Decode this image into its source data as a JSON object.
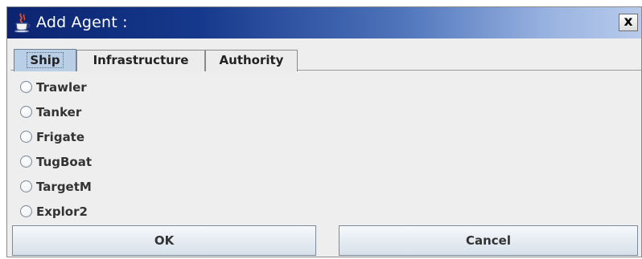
{
  "window": {
    "title": "Add Agent :",
    "close_glyph": "x"
  },
  "tabs": [
    {
      "label": "Ship",
      "selected": true
    },
    {
      "label": "Infrastructure",
      "selected": false
    },
    {
      "label": "Authority",
      "selected": false
    }
  ],
  "agent_options": [
    {
      "label": "Trawler",
      "selected": false
    },
    {
      "label": "Tanker",
      "selected": false
    },
    {
      "label": "Frigate",
      "selected": false
    },
    {
      "label": "TugBoat",
      "selected": false
    },
    {
      "label": "TargetM",
      "selected": false
    },
    {
      "label": "Explor2",
      "selected": false
    }
  ],
  "buttons": {
    "ok_label": "OK",
    "cancel_label": "Cancel"
  },
  "icons": {
    "title": "java-cup-icon",
    "close": "close-icon",
    "radio": "radio-button-icon"
  },
  "colors": {
    "titlebar_start": "#0b2470",
    "titlebar_end": "#b8cbeb",
    "selected_tab": "#b9cfe6",
    "background": "#eeeeee"
  }
}
